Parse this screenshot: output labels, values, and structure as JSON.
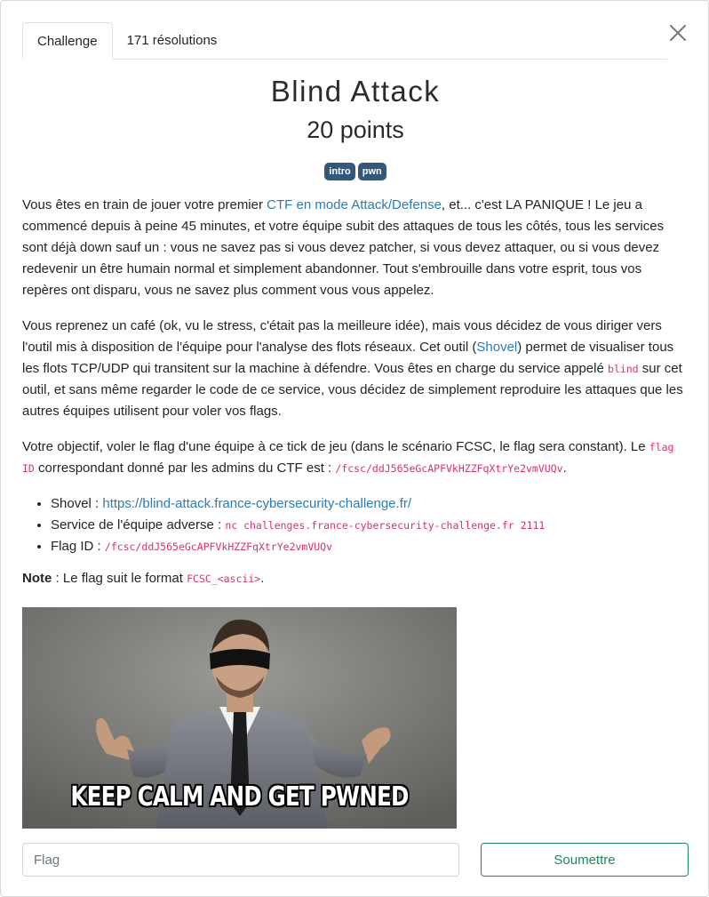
{
  "tabs": {
    "challenge": "Challenge",
    "solves": "171 résolutions"
  },
  "challenge": {
    "title": "Blind Attack",
    "points": "20 points",
    "tags": [
      "intro",
      "pwn"
    ]
  },
  "description": {
    "p1": {
      "before": "Vous êtes en train de jouer votre premier ",
      "link": "CTF en mode Attack/Defense",
      "after": ", et... c'est LA PANIQUE ! Le jeu a commencé depuis à peine 45 minutes, et votre équipe subit des attaques de tous les côtés, tous les services sont déjà down sauf un : vous ne savez pas si vous devez patcher, si vous devez attaquer, ou si vous devez redevenir un être humain normal et simplement abandonner. Tout s'embrouille dans votre esprit, tous vos repères ont disparu, vous ne savez plus comment vous vous appelez."
    },
    "p2": {
      "part1": "Vous reprenez un café (ok, vu le stress, c'était pas la meilleure idée), mais vous décidez de vous diriger vers l'outil mis à disposition de l'équipe pour l'analyse des flots réseaux. Cet outil (",
      "link": "Shovel",
      "part2": ") permet de visualiser tous les flots TCP/UDP qui transitent sur la machine à défendre. Vous êtes en charge du service appelé ",
      "code": "blind",
      "part3": " sur cet outil, et sans même regarder le code de ce service, vous décidez de simplement reproduire les attaques que les autres équipes utilisent pour voler vos flags."
    },
    "p3": {
      "part1": "Votre objectif, voler le flag d'une équipe à ce tick de jeu (dans le scénario FCSC, le flag sera constant). Le ",
      "code1": "flag ID",
      "part2": " correspondant donné par les admins du CTF est : ",
      "code2": "/fcsc/ddJ565eGcAPFVkHZZFqXtrYe2vmVUQv",
      "part3": "."
    },
    "list": {
      "shovel_label": "Shovel : ",
      "shovel_link": "https://blind-attack.france-cybersecurity-challenge.fr/",
      "service_label": "Service de l'équipe adverse : ",
      "service_code": "nc challenges.france-cybersecurity-challenge.fr 2111",
      "flagid_label": "Flag ID : ",
      "flagid_code": "/fcsc/ddJ565eGcAPFVkHZZFqXtrYe2vmVUQv"
    },
    "note": {
      "bold": "Note",
      "text": " : Le flag suit le format ",
      "code": "FCSC_<ascii>",
      "end": "."
    }
  },
  "meme": {
    "caption": "KEEP CALM AND GET PWNED"
  },
  "form": {
    "placeholder": "Flag",
    "submit": "Soumettre"
  },
  "colors": {
    "link": "#2c7bb6",
    "tag": "#35587a",
    "code": "#d6336c",
    "submit": "#1e8a5a"
  }
}
